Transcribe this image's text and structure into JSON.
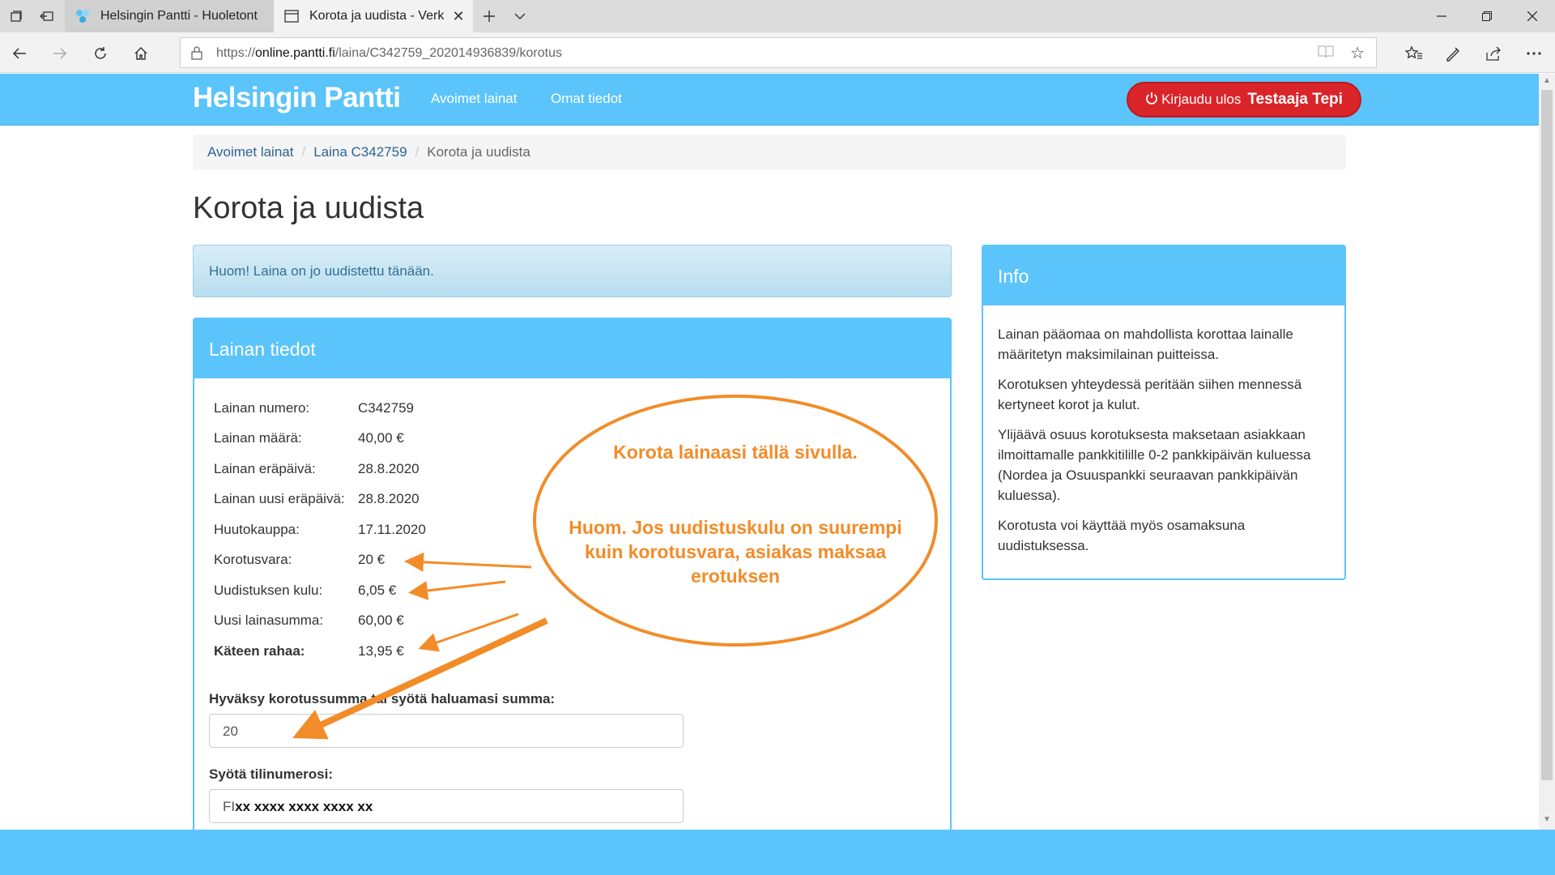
{
  "browser": {
    "tabs": [
      {
        "title": "Helsingin Pantti - Huoletont",
        "active": false
      },
      {
        "title": "Korota ja uudista - Verk",
        "active": true
      }
    ],
    "url_prefix": "https://",
    "url_host": "online.pantti.fi",
    "url_path": "/laina/C342759_202014936839/korotus",
    "icons": [
      "tab-list-icon",
      "set-aside-tabs-icon",
      "new-tab-icon",
      "tab-dropdown-icon",
      "minimize-icon",
      "maximize-icon",
      "close-window-icon",
      "back-icon",
      "forward-icon",
      "refresh-icon",
      "home-icon",
      "lock-icon",
      "reading-view-icon",
      "favorite-star-icon",
      "favorites-hub-icon",
      "pen-icon",
      "share-icon",
      "more-icon"
    ]
  },
  "site": {
    "brand": "Helsingin Pantti",
    "nav": [
      "Avoimet lainat",
      "Omat tiedot"
    ],
    "logout_label": "Kirjaudu ulos",
    "user_name": "Testaaja Tepi",
    "accent": "#5bc4fa",
    "logout_color": "#d9252a"
  },
  "breadcrumb": [
    "Avoimet lainat",
    "Laina C342759",
    "Korota ja uudista"
  ],
  "page_title": "Korota ja uudista",
  "alert_text": "Huom! Laina on jo uudistettu tänään.",
  "loan_panel": {
    "heading": "Lainan tiedot",
    "rows": [
      {
        "label": "Lainan numero:",
        "value": "C342759"
      },
      {
        "label": "Lainan määrä:",
        "value": "40,00 €"
      },
      {
        "label": "Lainan eräpäivä:",
        "value": "28.8.2020"
      },
      {
        "label": "Lainan uusi eräpäivä:",
        "value": "28.8.2020"
      },
      {
        "label": "Huutokauppa:",
        "value": "17.11.2020"
      },
      {
        "label": "Korotusvara:",
        "value": "20 €"
      },
      {
        "label": "Uudistuksen kulu:",
        "value": "6,05 €"
      },
      {
        "label": "Uusi lainasumma:",
        "value": "60,00 €"
      },
      {
        "label": "Käteen rahaa:",
        "value": "13,95 €"
      }
    ],
    "amount_label": "Hyväksy korotussumma tai syötä haluamasi summa:",
    "amount_value": "20",
    "account_label": "Syötä tilinumerosi:",
    "account_prefix": "FI",
    "account_value": "xx xxxx xxxx xxxx xx"
  },
  "info_panel": {
    "heading": "Info",
    "paragraphs": [
      "Lainan pääomaa on mahdollista korottaa lainalle määritetyn maksimilainan puitteissa.",
      "Korotuksen yhteydessä peritään siihen mennessä kertyneet korot ja kulut.",
      "Ylijäävä osuus korotuksesta maksetaan asiakkaan ilmoittamalle pankkitilille 0-2 pankkipäivän kuluessa (Nordea ja Osuuspankki seuraavan pankkipäivän kuluessa).",
      "Korotusta voi käyttää myös osamaksuna uudistuksessa."
    ]
  },
  "annotation": {
    "line1": "Korota lainaasi tällä sivulla.",
    "line2": "Huom. Jos uudistuskulu on suurempi kuin korotusvara, asiakas maksaa erotuksen",
    "color": "#f28c28"
  }
}
